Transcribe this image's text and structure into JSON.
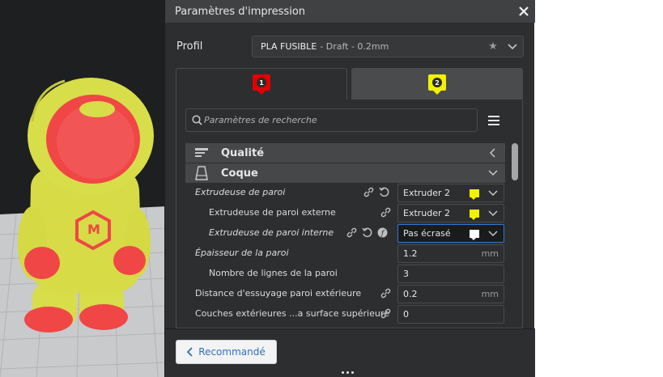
{
  "dialog": {
    "title": "Paramètres d'impression",
    "close_icon": "close-icon"
  },
  "profile": {
    "label": "Profil",
    "name": "PLA FUSIBLE",
    "sub": "- Draft - 0.2mm"
  },
  "tabs": [
    {
      "number": "1",
      "color": "#e20000"
    },
    {
      "number": "2",
      "color": "#f2f200"
    }
  ],
  "search": {
    "placeholder": "Paramètres de recherche"
  },
  "categories": {
    "quality": "Qualité",
    "shell": "Coque"
  },
  "settings": {
    "wall_extruder": {
      "label": "Extrudeuse de paroi",
      "value": "Extruder 2",
      "swatch": "#f2f200"
    },
    "outer_wall_extruder": {
      "label": "Extrudeuse de paroi externe",
      "value": "Extruder 2",
      "swatch": "#f2f200"
    },
    "inner_wall_extruder": {
      "label": "Extrudeuse de paroi interne",
      "value": "Pas écrasé",
      "swatch": "#ffffff"
    },
    "wall_thickness": {
      "label": "Épaisseur de la paroi",
      "value": "1.2",
      "unit": "mm"
    },
    "wall_line_count": {
      "label": "Nombre de lignes de la paroi",
      "value": "3"
    },
    "outer_wall_wipe": {
      "label": "Distance d'essuyage paroi extérieure",
      "value": "0.2",
      "unit": "mm"
    },
    "top_surface_layers": {
      "label": "Couches extérieures ...a surface supérieure",
      "value": "0"
    }
  },
  "footer": {
    "recommended_label": "Recommandé"
  },
  "model_logo": "M"
}
